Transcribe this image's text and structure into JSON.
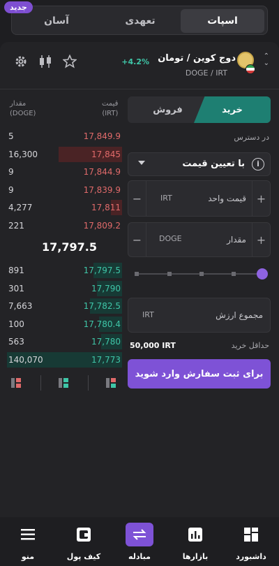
{
  "top_tabs": {
    "spot": "اسپات",
    "commitment": "تعهدی",
    "easy": "آسان",
    "new_badge": "جدید"
  },
  "header": {
    "pair_title": "دوج کوین / تومان",
    "pair_symbol": "DOGE / IRT",
    "change": "+4.2%",
    "icons": [
      "gear-icon",
      "candlestick-icon",
      "star-icon",
      "chevron-updown-icon"
    ]
  },
  "orderbook": {
    "price_header": "قیمت",
    "price_unit": "(IRT)",
    "amount_header": "مقدار",
    "amount_unit": "(DOGE)",
    "asks": [
      {
        "amount": "5",
        "price": "17,849.9",
        "depth": 0
      },
      {
        "amount": "16,300",
        "price": "17,845",
        "depth": 0.55
      },
      {
        "amount": "9",
        "price": "17,844.9",
        "depth": 0
      },
      {
        "amount": "9",
        "price": "17,839.9",
        "depth": 0
      },
      {
        "amount": "4,277",
        "price": "17,811",
        "depth": 0.1
      },
      {
        "amount": "221",
        "price": "17,809.2",
        "depth": 0
      }
    ],
    "mid_price": "17,797.5",
    "bids": [
      {
        "amount": "891",
        "price": "17,797.5",
        "depth": 0.25
      },
      {
        "amount": "301",
        "price": "17,790",
        "depth": 0.22
      },
      {
        "amount": "7,663",
        "price": "17,782.5",
        "depth": 0.28
      },
      {
        "amount": "100",
        "price": "17,780.4",
        "depth": 0.2
      },
      {
        "amount": "563",
        "price": "17,780",
        "depth": 0.18
      },
      {
        "amount": "140,070",
        "price": "17,773",
        "depth": 1.0
      }
    ]
  },
  "trade_form": {
    "buy_label": "خرید",
    "sell_label": "فروش",
    "available_label": "در دسترس",
    "order_type": "با تعیین قیمت",
    "unit_price_label": "قیمت واحد",
    "unit_price_currency": "IRT",
    "amount_label": "مقدار",
    "amount_currency": "DOGE",
    "total_label": "مجموع ارزش",
    "total_currency": "IRT",
    "min_buy_label": "حداقل خرید",
    "min_buy_value": "50,000 IRT",
    "submit_label": "برای ثبت سفارش وارد شوید",
    "slider_percent": 100
  },
  "bottom_nav": {
    "dashboard": "داشبورد",
    "markets": "بازارها",
    "exchange": "مبادله",
    "wallet": "کیف پول",
    "menu": "منو"
  },
  "colors": {
    "accent": "#7e52d6",
    "buy": "#1e7f72",
    "ask_text": "#e06a6a",
    "bid_text": "#3fc6a8"
  }
}
